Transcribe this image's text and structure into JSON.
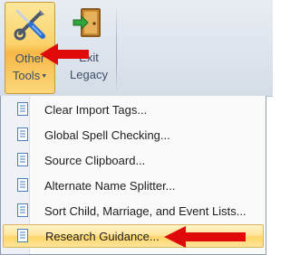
{
  "ribbon": {
    "other_tools": {
      "line1": "Other",
      "line2": "Tools",
      "icon": "tools-icon"
    },
    "exit_legacy": {
      "line1": "Exit",
      "line2": "Legacy",
      "icon": "exit-door-icon"
    }
  },
  "menu": {
    "items": [
      {
        "label": "Clear Import Tags...",
        "icon": "document-icon"
      },
      {
        "label": "Global Spell Checking...",
        "icon": "document-icon"
      },
      {
        "label": "Source Clipboard...",
        "icon": "document-icon"
      },
      {
        "label": "Alternate Name Splitter...",
        "icon": "document-icon"
      },
      {
        "label": "Sort Child, Marriage, and Event Lists...",
        "icon": "document-icon"
      },
      {
        "label": "Research Guidance...",
        "icon": "document-icon",
        "highlighted": true
      }
    ]
  },
  "colors": {
    "accent_arrow": "#e00a0a",
    "highlight": "#ffe699",
    "ribbon_label": "#3c4d66"
  }
}
